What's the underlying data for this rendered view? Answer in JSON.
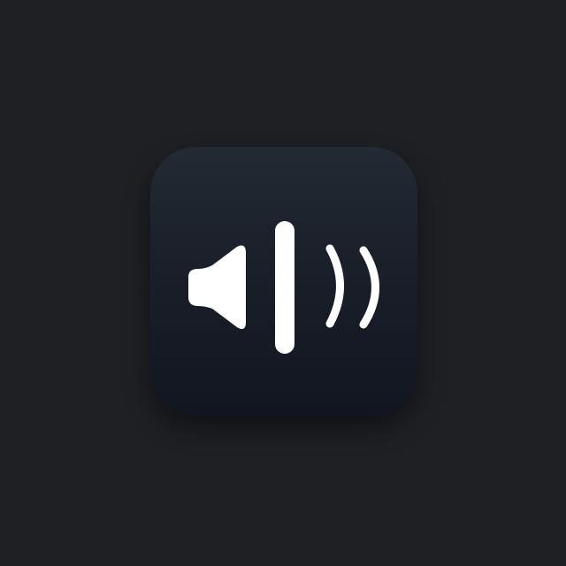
{
  "icon": {
    "name": "speaker-volume-icon",
    "colors": {
      "background": "#1f2024",
      "tile_top": "#232a34",
      "tile_bottom": "#121620",
      "glyph": "#ffffff"
    },
    "parts": [
      "speaker-cone-icon",
      "divider-bar",
      "sound-wave-small",
      "sound-wave-large"
    ]
  }
}
